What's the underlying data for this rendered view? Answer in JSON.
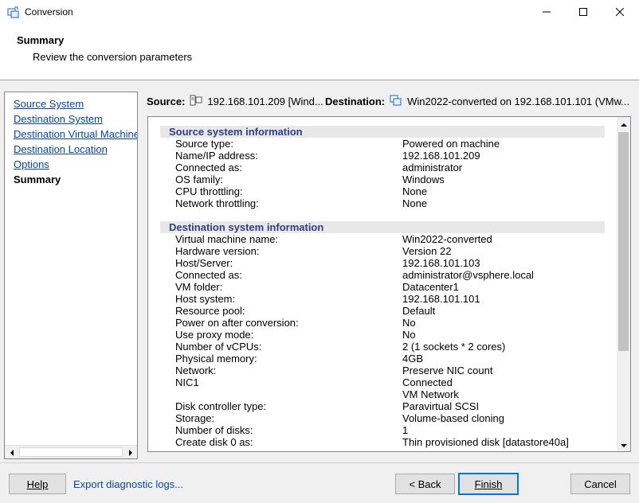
{
  "window": {
    "title": "Conversion",
    "icon": "conversion-app-icon"
  },
  "header": {
    "title": "Summary",
    "subtitle": "Review the conversion parameters"
  },
  "nav": {
    "items": [
      {
        "label": "Source System",
        "active": false
      },
      {
        "label": "Destination System",
        "active": false
      },
      {
        "label": "Destination Virtual Machine",
        "active": false
      },
      {
        "label": "Destination Location",
        "active": false
      },
      {
        "label": "Options",
        "active": false
      },
      {
        "label": "Summary",
        "active": true
      }
    ]
  },
  "source_bar": {
    "source_label": "Source:",
    "source_value": "192.168.101.209 [Wind...",
    "destination_label": "Destination:",
    "destination_value": "Win2022-converted on 192.168.101.101 (VMw..."
  },
  "details": {
    "source_section": {
      "title": "Source system information",
      "rows": [
        {
          "key": "Source type:",
          "value": "Powered on machine"
        },
        {
          "key": "Name/IP address:",
          "value": "192.168.101.209"
        },
        {
          "key": "Connected as:",
          "value": "administrator"
        },
        {
          "key": "OS family:",
          "value": "Windows"
        },
        {
          "key": "CPU throttling:",
          "value": "None"
        },
        {
          "key": "Network throttling:",
          "value": "None"
        }
      ]
    },
    "destination_section": {
      "title": "Destination system information",
      "rows": [
        {
          "key": "Virtual machine name:",
          "value": "Win2022-converted"
        },
        {
          "key": "Hardware version:",
          "value": "Version 22"
        },
        {
          "key": "Host/Server:",
          "value": "192.168.101.103"
        },
        {
          "key": "Connected as:",
          "value": "administrator@vsphere.local"
        },
        {
          "key": "VM folder:",
          "value": "Datacenter1"
        },
        {
          "key": "Host system:",
          "value": "192.168.101.101"
        },
        {
          "key": "Resource pool:",
          "value": "Default"
        },
        {
          "key": "Power on after conversion:",
          "value": "No"
        },
        {
          "key": "Use proxy mode:",
          "value": "No"
        },
        {
          "key": "Number of vCPUs:",
          "value": "2 (1 sockets * 2 cores)"
        },
        {
          "key": "Physical memory:",
          "value": "4GB"
        },
        {
          "key": "Network:",
          "value": "Preserve NIC count"
        },
        {
          "key": "NIC1",
          "value": "Connected"
        },
        {
          "key": "",
          "value": "VM Network"
        },
        {
          "key": "Disk controller type:",
          "value": "Paravirtual SCSI"
        },
        {
          "key": "Storage:",
          "value": "Volume-based cloning"
        },
        {
          "key": "Number of disks:",
          "value": "1"
        },
        {
          "key": "Create disk 0 as:",
          "value": "Thin provisioned disk [datastore40a]"
        }
      ]
    }
  },
  "footer": {
    "help_label": "Help",
    "export_label": "Export diagnostic logs...",
    "back_label": "< Back",
    "finish_label": "Finish",
    "cancel_label": "Cancel"
  }
}
